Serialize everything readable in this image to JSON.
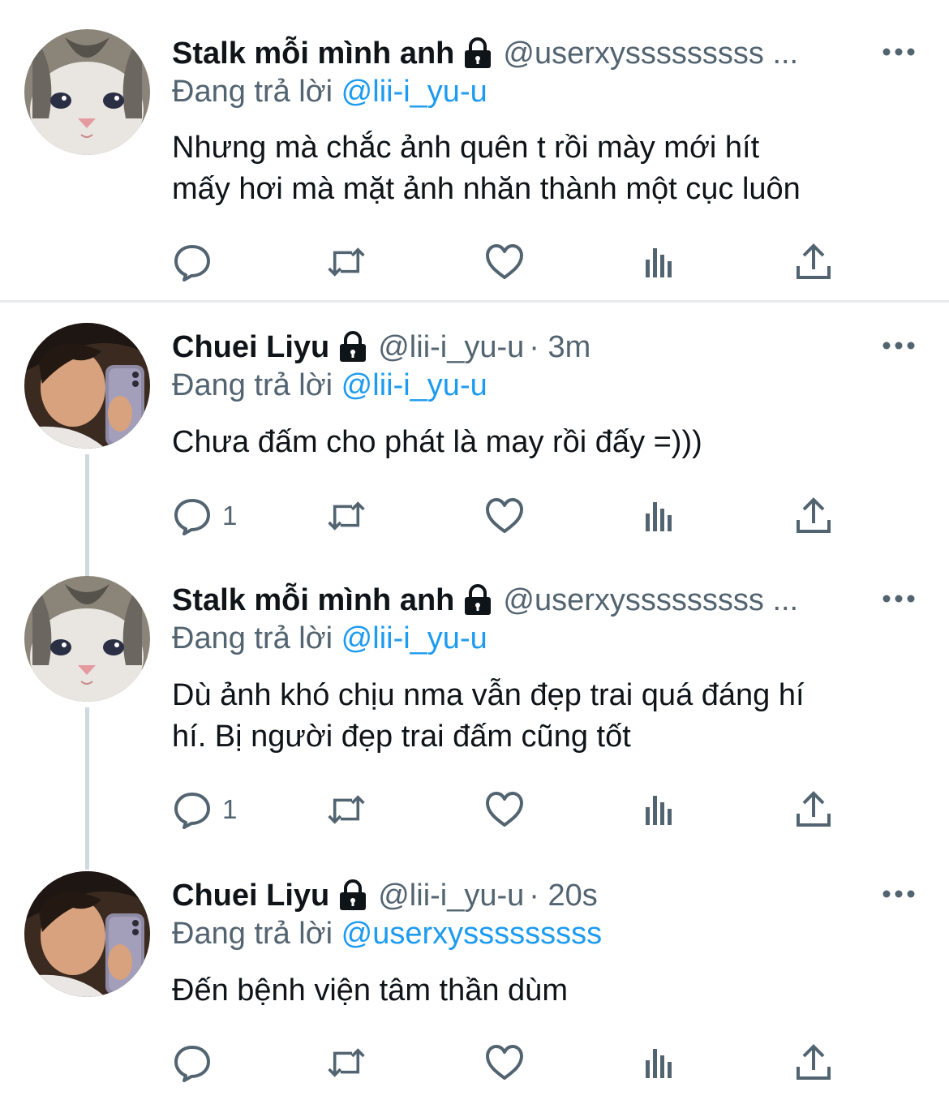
{
  "colors": {
    "text": "#0f1419",
    "secondary": "#536471",
    "link": "#1d9bf0",
    "thread_line": "#cfd9de",
    "divider": "#e7ebee"
  },
  "icons": [
    "lock-icon",
    "more-icon",
    "reply-icon",
    "retweet-icon",
    "like-icon",
    "analytics-icon",
    "share-icon"
  ],
  "replying_prefix": "Đang trả lời",
  "tweets": [
    {
      "name": "Stalk mỗi mình anh",
      "handle": "@userxysssssssss ...",
      "time": "",
      "replying_to": "@lii-i_yu-u",
      "text_lines": [
        "Nhưng mà chắc ảnh quên t rồi mày mới hít",
        "mấy hơi mà mặt ảnh nhăn thành một cục luôn"
      ],
      "reply_count": ""
    },
    {
      "name": "Chuei Liyu",
      "handle": "@lii-i_yu-u",
      "time": "· 3m",
      "replying_to": "@lii-i_yu-u",
      "text_lines": [
        "Chưa đấm cho phát là may rồi đấy =)))"
      ],
      "reply_count": "1"
    },
    {
      "name": "Stalk mỗi mình anh",
      "handle": "@userxysssssssss ...",
      "time": "",
      "replying_to": "@lii-i_yu-u",
      "text_lines": [
        "Dù ảnh khó chịu nma vẫn đẹp trai quá đáng hí",
        "hí. Bị người đẹp trai đấm cũng tốt"
      ],
      "reply_count": "1"
    },
    {
      "name": "Chuei Liyu",
      "handle": "@lii-i_yu-u",
      "time": "· 20s",
      "replying_to": "@userxysssssssss",
      "text_lines": [
        "Đến bệnh viện tâm thần dùm"
      ],
      "reply_count": ""
    }
  ]
}
